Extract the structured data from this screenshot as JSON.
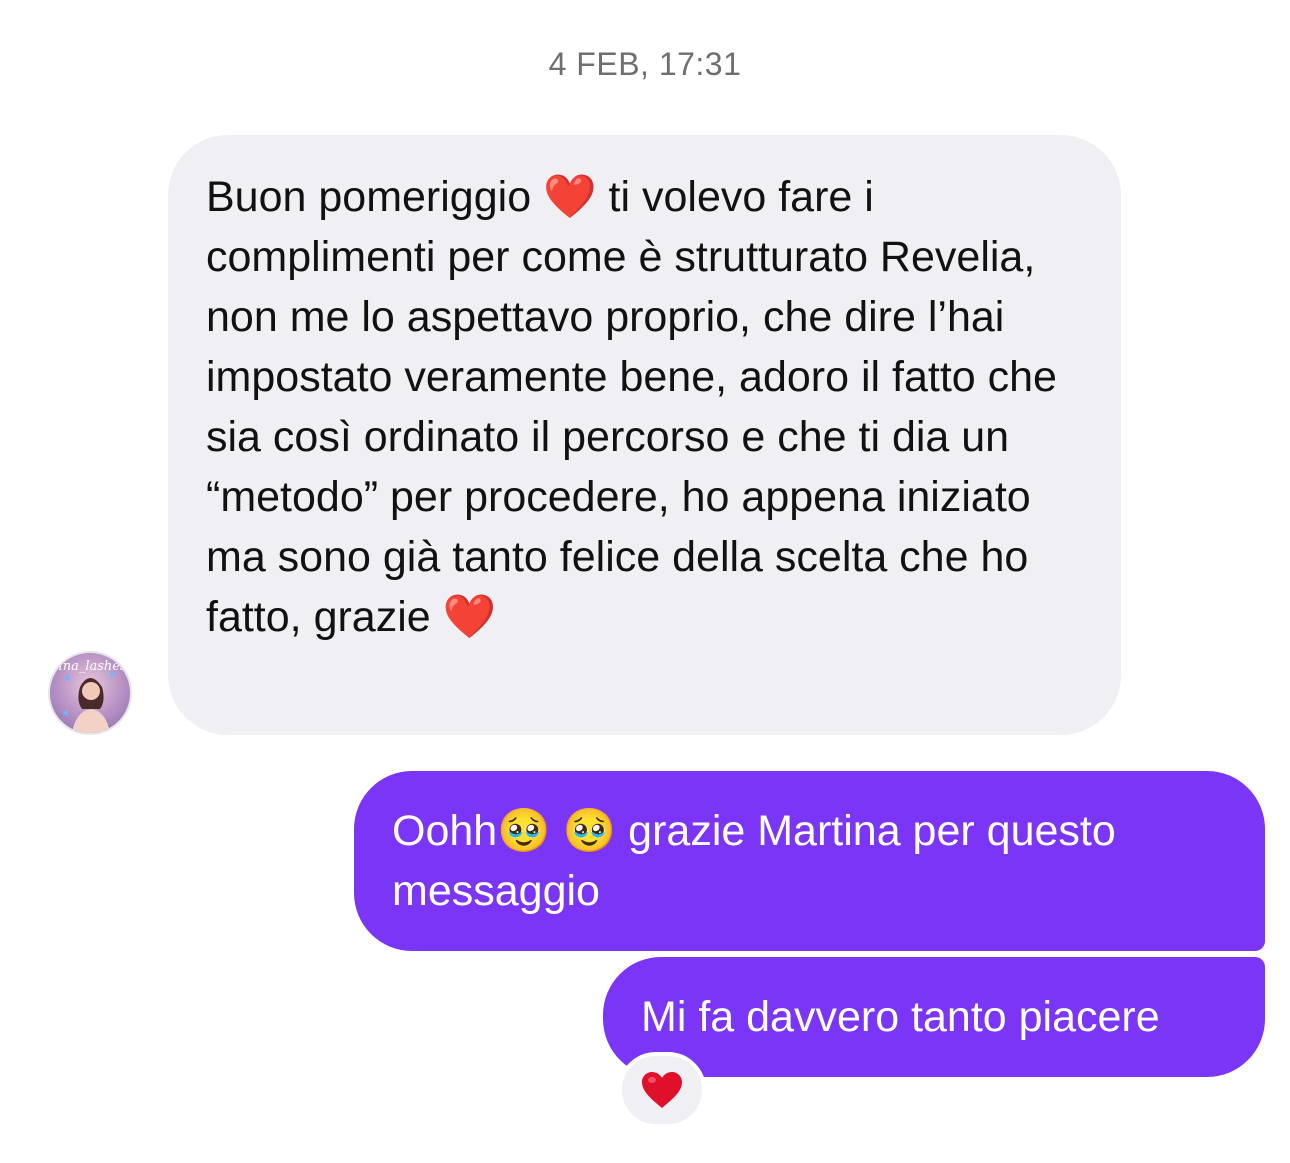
{
  "timestamp": "4 FEB, 17:31",
  "contact": {
    "avatar_caption": "tina_lashes"
  },
  "messages": [
    {
      "direction": "incoming",
      "text": "Buon pomeriggio ❤️ ti volevo fare i complimenti per come è strutturato Revelia, non me lo aspettavo proprio, che dire l’hai impostato veramente bene, adoro il fatto che sia così ordinato il percorso e che ti dia un “metodo” per procedere, ho appena iniziato ma sono già tanto felice della scelta che ho fatto, grazie ❤️"
    },
    {
      "direction": "outgoing",
      "text": "Oohh🥹 🥹 grazie Martina per questo messaggio"
    },
    {
      "direction": "outgoing",
      "text": "Mi fa davvero tanto piacere",
      "reaction": "❤️"
    }
  ],
  "colors": {
    "incoming_bubble": "#efeff4",
    "outgoing_bubble": "#7a35f6",
    "timestamp_text": "#6e6e73"
  },
  "icons": {
    "reaction": "heart-icon"
  }
}
